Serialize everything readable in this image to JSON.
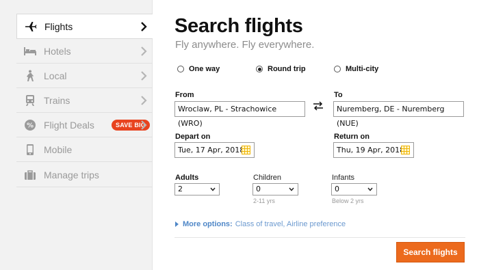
{
  "sidebar": {
    "items": [
      {
        "label": "Flights",
        "icon": "airplane-icon",
        "active": true
      },
      {
        "label": "Hotels",
        "icon": "bed-icon",
        "active": false
      },
      {
        "label": "Local",
        "icon": "hiker-icon",
        "active": false
      },
      {
        "label": "Trains",
        "icon": "train-icon",
        "active": false
      },
      {
        "label": "Flight Deals",
        "icon": "percent-badge-icon",
        "active": false,
        "badge": "SAVE BIG"
      },
      {
        "label": "Mobile",
        "icon": "mobile-phone-icon",
        "active": false
      },
      {
        "label": "Manage trips",
        "icon": "briefcase-icon",
        "active": false
      }
    ]
  },
  "header": {
    "title": "Search flights",
    "subtitle": "Fly anywhere. Fly everywhere."
  },
  "trip_type": {
    "options": [
      {
        "label": "One way",
        "selected": false
      },
      {
        "label": "Round trip",
        "selected": true
      },
      {
        "label": "Multi-city",
        "selected": false
      }
    ]
  },
  "from": {
    "label": "From",
    "value": "Wroclaw, PL - Strachowice (WRO)"
  },
  "to": {
    "label": "To",
    "value": "Nuremberg, DE - Nuremberg (NUE)"
  },
  "depart": {
    "label": "Depart on",
    "value": "Tue, 17 Apr, 2018"
  },
  "return": {
    "label": "Return on",
    "value": "Thu, 19 Apr, 2018"
  },
  "passengers": {
    "adults": {
      "label": "Adults",
      "value": "2"
    },
    "children": {
      "label": "Children",
      "value": "0",
      "hint": "2-11 yrs"
    },
    "infants": {
      "label": "Infants",
      "value": "0",
      "hint": "Below 2 yrs"
    }
  },
  "more_options": {
    "label": "More options:",
    "detail": "Class of travel, Airline preference"
  },
  "search_button": {
    "label": "Search flights"
  },
  "colors": {
    "accent": "#ec6a1d",
    "badge": "#e8431f",
    "link": "#4f87c7",
    "calendar": "#f0b400"
  }
}
